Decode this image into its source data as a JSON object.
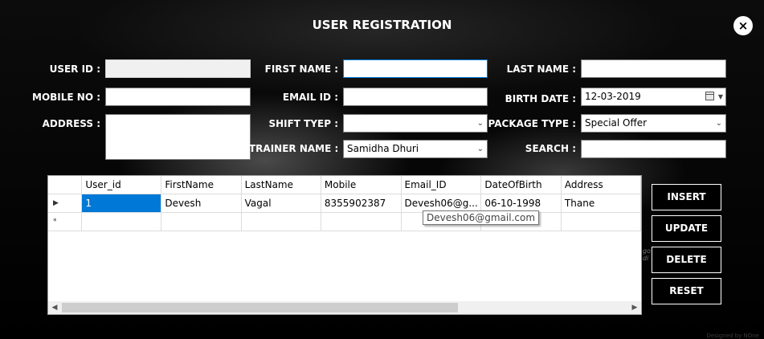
{
  "window": {
    "title": "USER REGISTRATION",
    "close_glyph": "×"
  },
  "labels": {
    "user_id": "USER ID :",
    "mobile_no": "MOBILE NO :",
    "address": "ADDRESS :",
    "first_name": "FIRST NAME :",
    "email_id": "EMAIL ID :",
    "shift_type": "SHIFT TYEP :",
    "trainer_name": "TRAINER NAME :",
    "last_name": "LAST NAME :",
    "birth_date": "BIRTH DATE :",
    "package_type": "PACKAGE TYPE :",
    "search": "SEARCH :"
  },
  "fields": {
    "user_id": "",
    "mobile_no": "",
    "address": "",
    "first_name": "",
    "email_id": "",
    "shift_type": "",
    "trainer_name": "Samidha Dhuri",
    "last_name": "",
    "birth_date": "12-03-2019",
    "package_type": "Special Offer",
    "search": ""
  },
  "grid": {
    "columns": [
      "User_id",
      "FirstName",
      "LastName",
      "Mobile",
      "Email_ID",
      "DateOfBirth",
      "Address"
    ],
    "rows": [
      {
        "indicator": "▶",
        "cells": [
          "1",
          "Devesh",
          "Vagal",
          "8355902387",
          "Devesh06@g...",
          "06-10-1998",
          "Thane"
        ]
      }
    ],
    "new_row_indicator": "*",
    "tooltip": "Devesh06@gmail.com",
    "scroll_left": "◀",
    "scroll_right": "▶"
  },
  "buttons": {
    "insert": "INSERT",
    "update": "UPDATE",
    "delete": "DELETE",
    "reset": "RESET"
  },
  "edge_text": "go\ndi",
  "credit": "Designed by NOne",
  "icons": {
    "dropdown": "chevron-down-icon",
    "calendar": "calendar-icon",
    "close": "close-icon"
  }
}
